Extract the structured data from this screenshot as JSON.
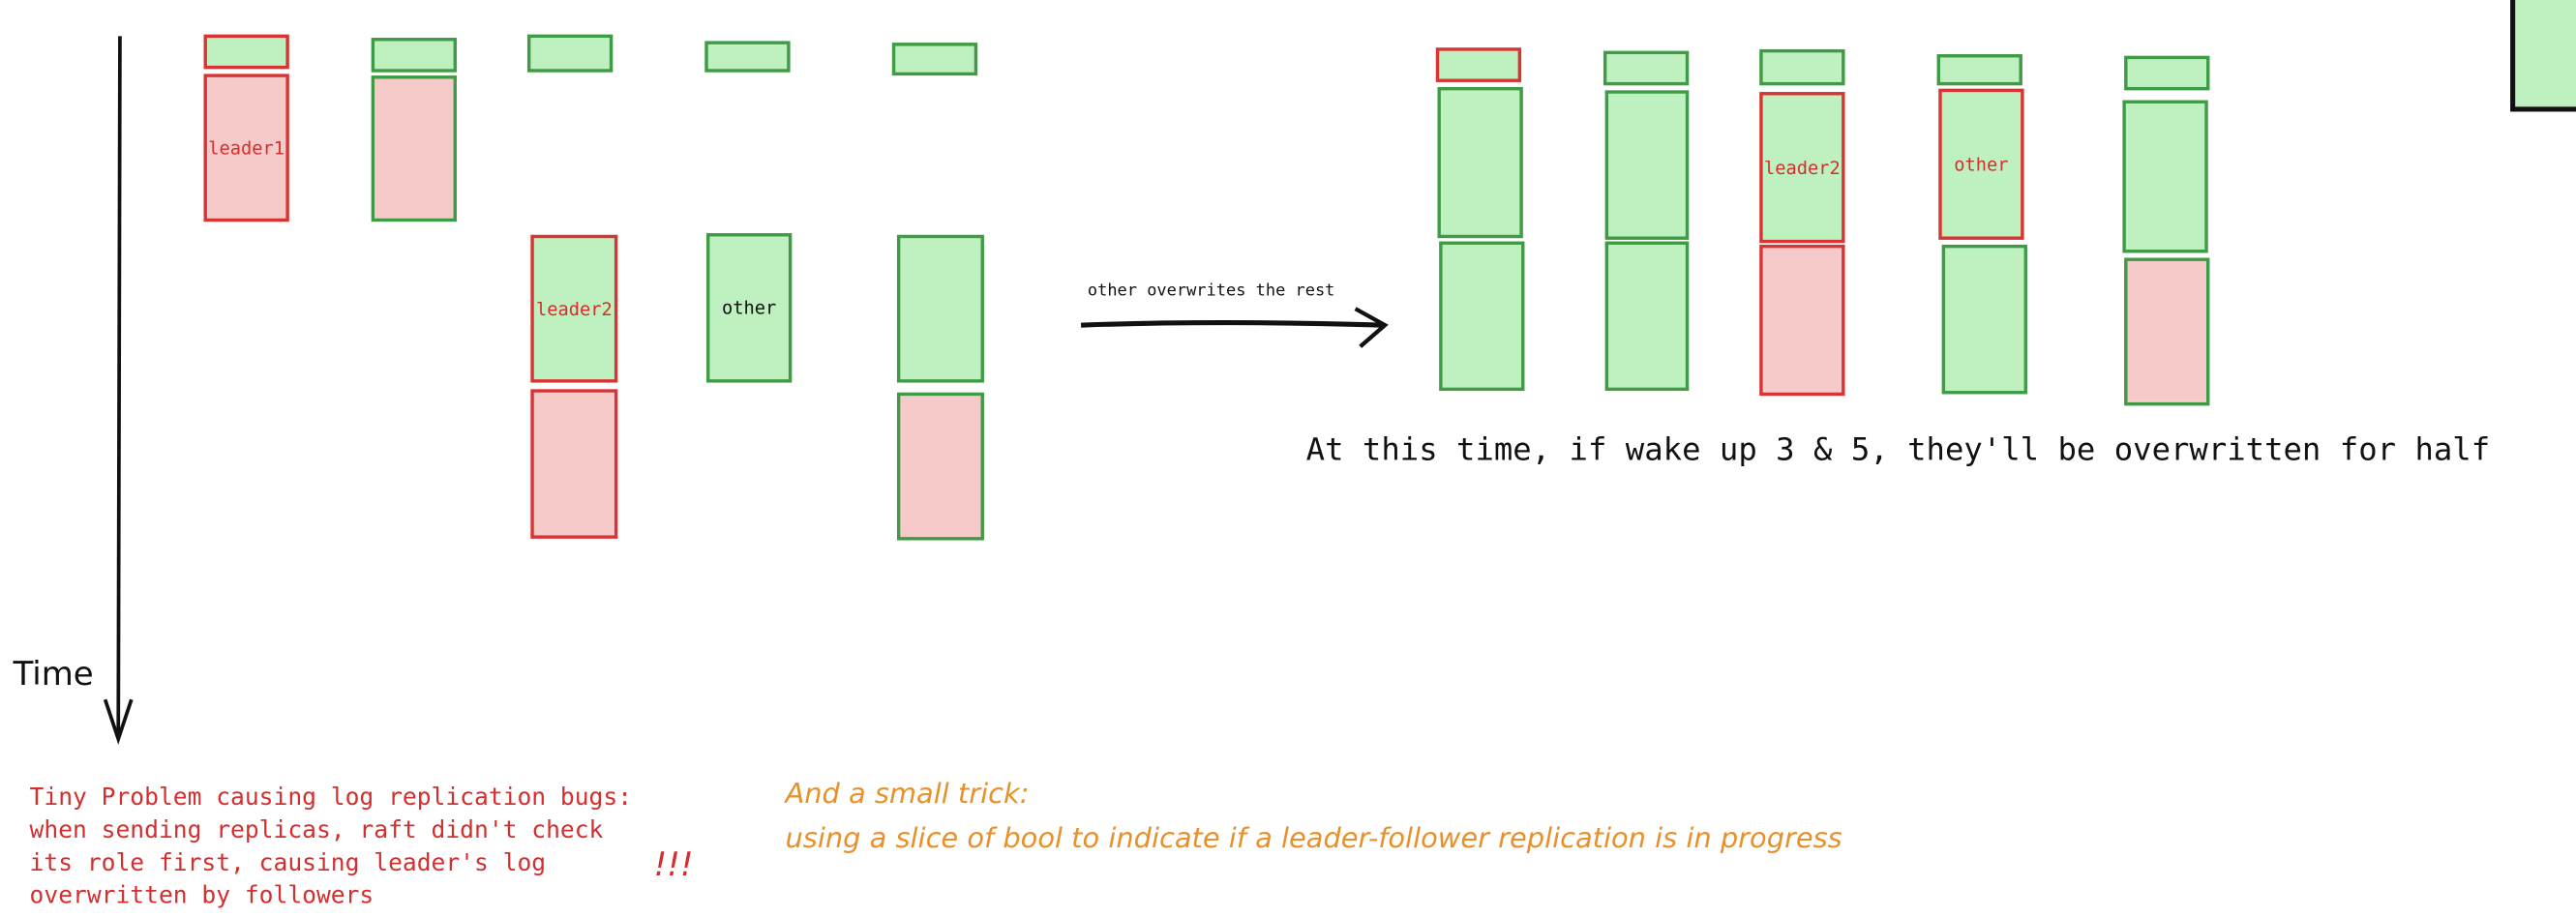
{
  "colors": {
    "green_fill": "#bff0bf",
    "green_stroke": "#3f9b45",
    "red_stroke": "#d93434",
    "pink_fill": "#f7caca",
    "orange": "#e8902a",
    "red_text": "#d32f2f"
  },
  "axis": {
    "label": "Time"
  },
  "before": {
    "labels": {
      "leader1": "leader1",
      "leader2": "leader2",
      "other": "other"
    }
  },
  "transition": {
    "label": "other overwrites the rest"
  },
  "after": {
    "labels": {
      "leader2": "leader2",
      "other": "other"
    }
  },
  "note_after": "At this time, if wake up 3 & 5, they'll be overwritten for half",
  "problem": {
    "lines": [
      "Tiny Problem causing log replication bugs:",
      "when sending replicas, raft didn't check",
      "its role first, causing leader's log",
      "overwritten by followers"
    ],
    "emphasis": "!!!"
  },
  "trick": {
    "lines": [
      "And a small trick:",
      "using a slice of bool to indicate if a leader-follower replication is in progress"
    ]
  }
}
